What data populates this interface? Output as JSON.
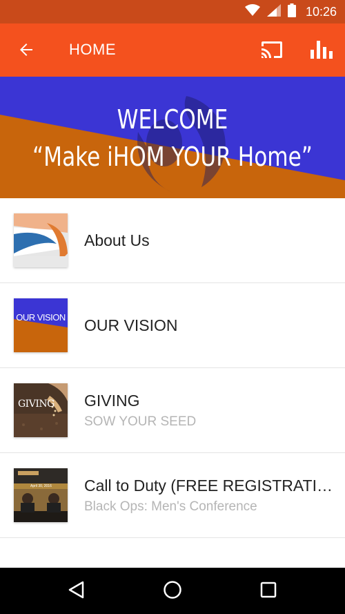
{
  "status_bar": {
    "time": "10:26"
  },
  "app_bar": {
    "title": "HOME"
  },
  "banner": {
    "welcome": "WELCOME",
    "tagline": "“Make iHOM YOUR Home”"
  },
  "items": [
    {
      "title": "About Us",
      "subtitle": ""
    },
    {
      "title": "OUR VISION",
      "subtitle": "",
      "thumb_text": "OUR VISION"
    },
    {
      "title": "GIVING",
      "subtitle": "SOW YOUR SEED",
      "thumb_text": "GIVING"
    },
    {
      "title": "Call to Duty (FREE REGISTRATION)",
      "subtitle": "Black Ops: Men's Conference",
      "thumb_text": "April 30, 2016"
    }
  ],
  "colors": {
    "status_bar": "#c94a1a",
    "app_bar": "#f4511e",
    "banner_blue": "#3b35d4",
    "banner_orange": "#c8650c"
  },
  "icons": {
    "back": "arrow-back-icon",
    "cast": "cast-icon",
    "stats": "bar-chart-icon",
    "nav_back": "triangle-back-icon",
    "nav_home": "circle-home-icon",
    "nav_recent": "square-recent-icon"
  }
}
